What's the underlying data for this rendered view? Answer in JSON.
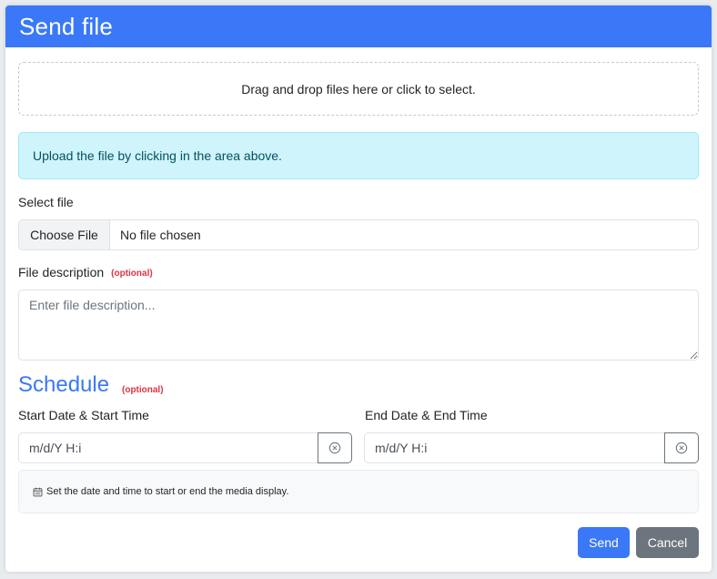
{
  "modal": {
    "title": "Send file"
  },
  "dropzone": {
    "text": "Drag and drop files here or click to select."
  },
  "alert": {
    "text": "Upload the file by clicking in the area above."
  },
  "select_file": {
    "label": "Select file",
    "button_label": "Choose File",
    "status": "No file chosen"
  },
  "description": {
    "label": "File description",
    "optional": "(optional)",
    "placeholder": "Enter file description..."
  },
  "schedule": {
    "title": "Schedule",
    "optional": "(optional)",
    "start": {
      "label": "Start Date & Start Time",
      "placeholder": "m/d/Y H:i"
    },
    "end": {
      "label": "End Date & End Time",
      "placeholder": "m/d/Y H:i"
    },
    "help": "Set the date and time to start or end the media display."
  },
  "footer": {
    "send_label": "Send",
    "cancel_label": "Cancel"
  },
  "colors": {
    "primary": "#3a78f7",
    "secondary": "#6c757d",
    "info_bg": "#cff4fc",
    "danger": "#dc3545"
  },
  "icons": {
    "clear": "circle-x-icon",
    "calendar": "calendar-icon"
  }
}
